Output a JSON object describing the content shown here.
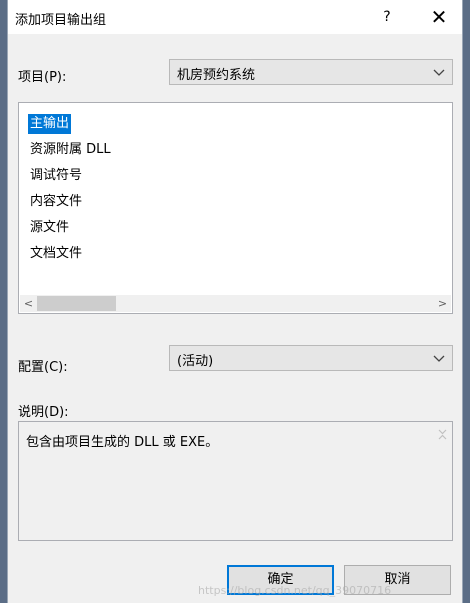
{
  "dialog": {
    "title": "添加项目输出组",
    "help_label": "?",
    "close_label": "✕"
  },
  "project": {
    "label": "项目(P):",
    "selected": "机房预约系统"
  },
  "outputs": {
    "items": [
      {
        "label": "主输出",
        "selected": true
      },
      {
        "label": "资源附属 DLL",
        "selected": false
      },
      {
        "label": "调试符号",
        "selected": false
      },
      {
        "label": "内容文件",
        "selected": false
      },
      {
        "label": "源文件",
        "selected": false
      },
      {
        "label": "文档文件",
        "selected": false
      }
    ],
    "scroll_left": "<",
    "scroll_right": ">"
  },
  "config": {
    "label": "配置(C):",
    "selected": "(活动)"
  },
  "description": {
    "label": "说明(D):",
    "text": "包含由项目生成的 DLL 或 EXE。"
  },
  "buttons": {
    "ok": "确定",
    "cancel": "取消"
  },
  "watermark": "https://blog.csdn.net/qq_39070716"
}
